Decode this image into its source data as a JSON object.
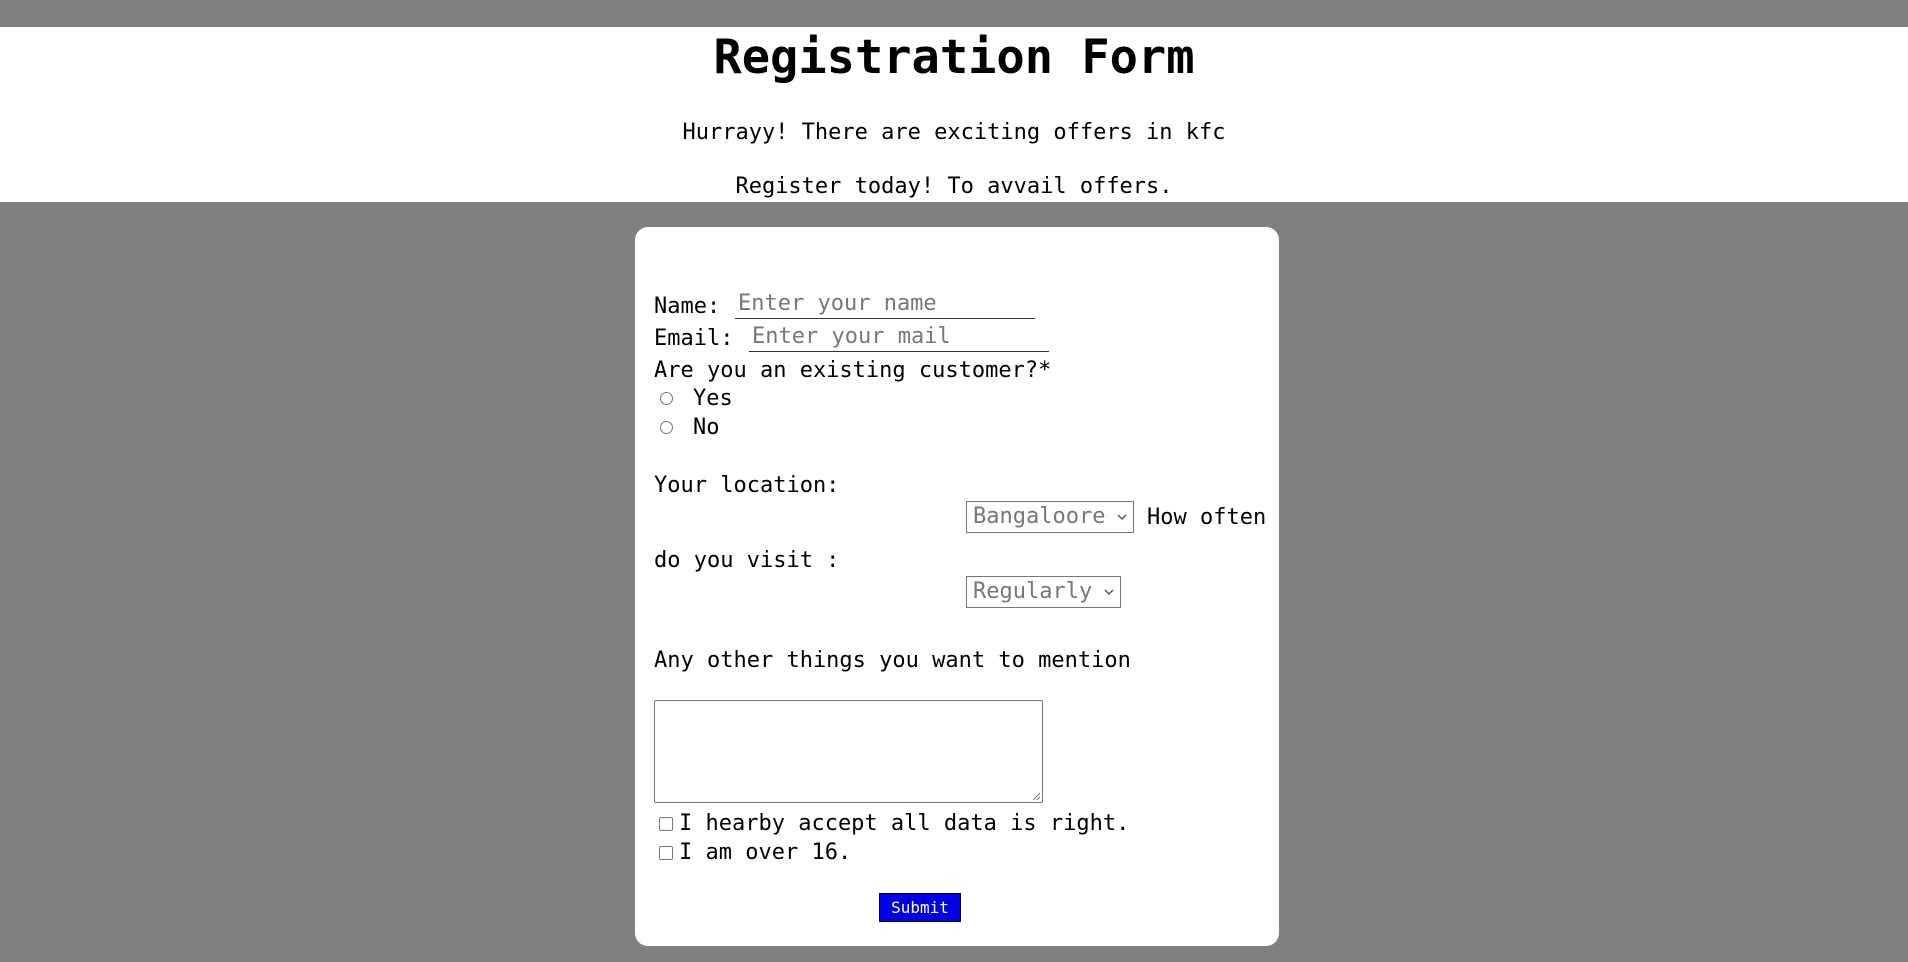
{
  "header": {
    "title": "Registration Form",
    "tagline_1": "Hurrayy! There are exciting offers in kfc",
    "tagline_2": "Register today! To avvail offers."
  },
  "form": {
    "name_label": "Name:",
    "name_placeholder": "Enter your name",
    "email_label": "Email:",
    "email_placeholder": "Enter your mail",
    "customer_question": "Are you an existing customer?*",
    "customer_options": [
      {
        "label": "Yes",
        "checked": false
      },
      {
        "label": "No",
        "checked": false
      }
    ],
    "location_label": "Your location:",
    "location_value": "Bangaloore",
    "visit_label_part1": "How often",
    "visit_label_part2": "do you visit :",
    "visit_value": "Regularly",
    "comments_label": "Any other things you want to mention",
    "comments_value": "",
    "checkboxes": [
      {
        "label": "I hearby accept all data is right.",
        "checked": false
      },
      {
        "label": "I am over 16.",
        "checked": false
      }
    ],
    "submit_label": "Submit"
  },
  "colors": {
    "page_background": "#808080",
    "card_background": "#ffffff",
    "submit_background": "#0000e6",
    "submit_text": "#ffffff"
  }
}
